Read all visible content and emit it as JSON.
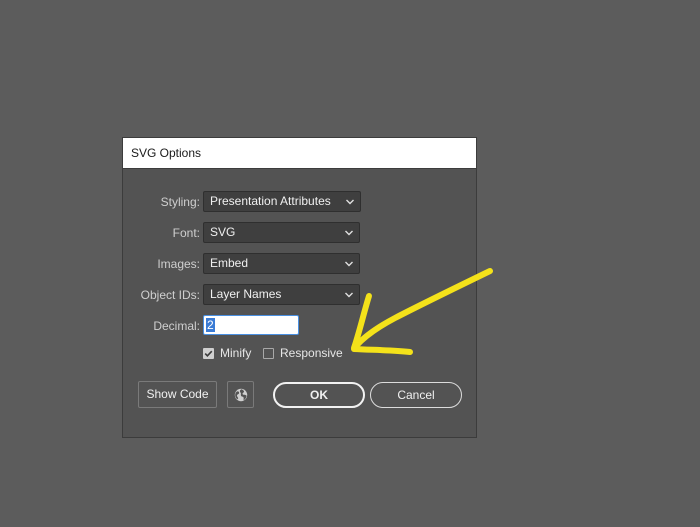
{
  "dialog": {
    "title": "SVG Options",
    "fields": {
      "styling": {
        "label": "Styling:",
        "value": "Presentation Attributes"
      },
      "font": {
        "label": "Font:",
        "value": "SVG"
      },
      "images": {
        "label": "Images:",
        "value": "Embed"
      },
      "object_ids": {
        "label": "Object IDs:",
        "value": "Layer Names"
      },
      "decimal": {
        "label": "Decimal:",
        "value": "2"
      }
    },
    "checkboxes": {
      "minify": {
        "label": "Minify",
        "checked": true
      },
      "responsive": {
        "label": "Responsive",
        "checked": false
      }
    },
    "buttons": {
      "show_code": "Show Code",
      "ok": "OK",
      "cancel": "Cancel"
    }
  },
  "icons": {
    "globe": "globe-icon",
    "chevron": "chevron-down-icon",
    "check": "check-icon"
  },
  "colors": {
    "background": "#5c5c5c",
    "dialog": "#535353",
    "annotation": "#f4e21a"
  }
}
